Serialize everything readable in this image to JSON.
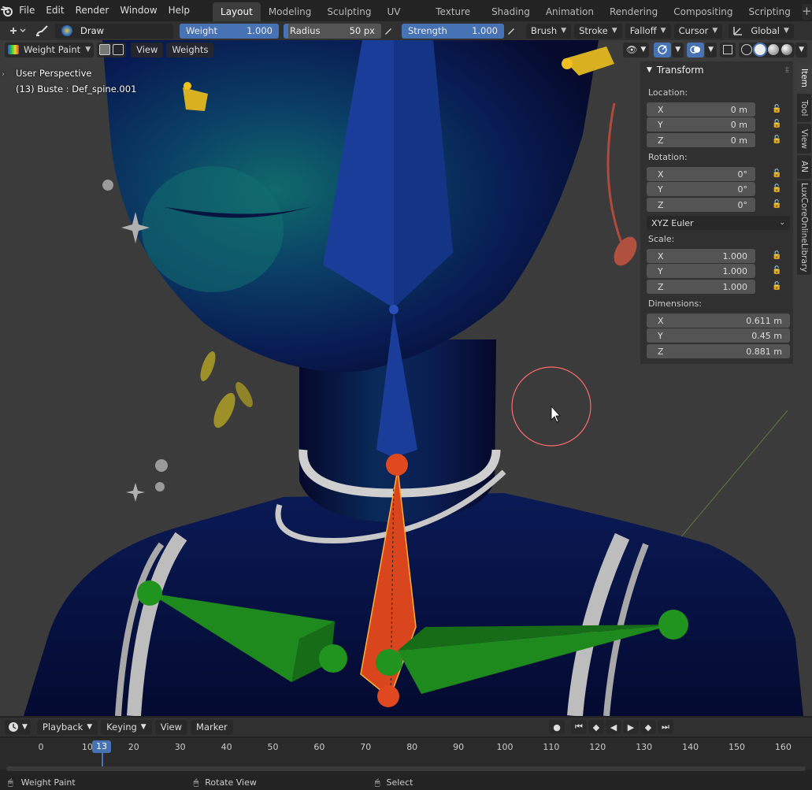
{
  "menus": [
    "File",
    "Edit",
    "Render",
    "Window",
    "Help"
  ],
  "workspaces": [
    "Layout",
    "Modeling",
    "Sculpting",
    "UV Editing",
    "Texture Paint",
    "Shading",
    "Animation",
    "Rendering",
    "Compositing",
    "Scripting"
  ],
  "active_workspace": "Layout",
  "tool": {
    "brush_name": "Draw",
    "weight_label": "Weight",
    "weight_value": "1.000",
    "radius_label": "Radius",
    "radius_value": "50 px",
    "strength_label": "Strength",
    "strength_value": "1.000",
    "brush_dd": "Brush",
    "stroke_dd": "Stroke",
    "falloff_dd": "Falloff",
    "cursor_dd": "Cursor",
    "orientation_dd": "Global"
  },
  "viewport": {
    "mode": "Weight Paint",
    "view_menu": "View",
    "weights_menu": "Weights",
    "perspective": "User Perspective",
    "object_info": "(13) Buste : Def_spine.001"
  },
  "npanel": {
    "title": "Transform",
    "location_label": "Location:",
    "location": [
      {
        "axis": "X",
        "value": "0 m"
      },
      {
        "axis": "Y",
        "value": "0 m"
      },
      {
        "axis": "Z",
        "value": "0 m"
      }
    ],
    "rotation_label": "Rotation:",
    "rotation": [
      {
        "axis": "X",
        "value": "0°"
      },
      {
        "axis": "Y",
        "value": "0°"
      },
      {
        "axis": "Z",
        "value": "0°"
      }
    ],
    "rotation_mode": "XYZ Euler",
    "scale_label": "Scale:",
    "scale": [
      {
        "axis": "X",
        "value": "1.000"
      },
      {
        "axis": "Y",
        "value": "1.000"
      },
      {
        "axis": "Z",
        "value": "1.000"
      }
    ],
    "dimensions_label": "Dimensions:",
    "dimensions": [
      {
        "axis": "X",
        "value": "0.611 m"
      },
      {
        "axis": "Y",
        "value": "0.45 m"
      },
      {
        "axis": "Z",
        "value": "0.881 m"
      }
    ]
  },
  "sidetabs": [
    "Item",
    "Tool",
    "View",
    "AN",
    "LuxCoreOnlineLibrary"
  ],
  "timeline": {
    "playback": "Playback",
    "keying": "Keying",
    "view": "View",
    "marker": "Marker",
    "current_frame": "13",
    "ticks": [
      "0",
      "10",
      "20",
      "30",
      "40",
      "50",
      "60",
      "70",
      "80",
      "90",
      "100",
      "110",
      "120",
      "130",
      "140",
      "150",
      "160"
    ]
  },
  "status": {
    "left": "Weight Paint",
    "middle": "Rotate View",
    "right": "Select"
  }
}
